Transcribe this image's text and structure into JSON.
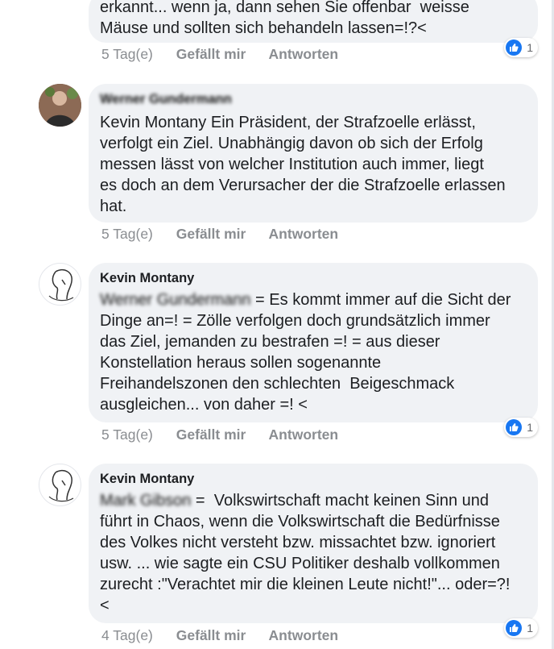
{
  "comments": [
    {
      "author": "",
      "lines": [
        "erkannt... wenn ja, dann sehen Sie offenbar  weisse",
        "Mäuse und sollten sich behandeln lassen=!?<"
      ],
      "time": "5 Tag(e)",
      "like": "Gefällt mir",
      "reply": "Antworten",
      "reactions": "1"
    },
    {
      "author": "Werner Gundermann",
      "lines": [
        "Kevin Montany Ein Präsident, der Strafzoelle erlässt,",
        "verfolgt ein Ziel. Unabhängig davon ob sich der Erfolg",
        "messen lässt von welcher Institution auch immer, liegt",
        "es doch an dem Verursacher der die Strafzoelle erlassen",
        "hat."
      ],
      "time": "5 Tag(e)",
      "like": "Gefällt mir",
      "reply": "Antworten"
    },
    {
      "author": "Kevin Montany",
      "mention": "Werner Gundermann",
      "lines": [
        " = Es kommt immer auf die Sicht der",
        "Dinge an=! = Zölle verfolgen doch grundsätzlich immer",
        "das Ziel, jemanden zu bestrafen =! = aus dieser",
        "Konstellation heraus sollen sogenannte",
        "Freihandelszonen den schlechten  Beigeschmack",
        "ausgleichen... von daher =! <"
      ],
      "time": "5 Tag(e)",
      "like": "Gefällt mir",
      "reply": "Antworten",
      "reactions": "1"
    },
    {
      "author": "Kevin Montany",
      "mention": "Mark Gibson",
      "lines": [
        " =  Volkswirtschaft macht keinen Sinn und",
        "führt in Chaos, wenn die Volkswirtschaft die Bedürfnisse",
        "des Volkes nicht versteht bzw. missachtet bzw. ignoriert",
        "usw. ... wie sagte ein CSU Politiker deshalb vollkommen",
        "zurecht :\"Verachtet mir die kleinen Leute nicht!\"... oder=?!",
        "<"
      ],
      "time": "4 Tag(e)",
      "like": "Gefällt mir",
      "reply": "Antworten",
      "reactions": "1"
    }
  ],
  "icons": {
    "like": "thumbs-up-icon"
  },
  "colors": {
    "like_blue": "#1877f2",
    "bubble_bg": "#f0f2f5",
    "meta_gray": "#8a8d91"
  }
}
